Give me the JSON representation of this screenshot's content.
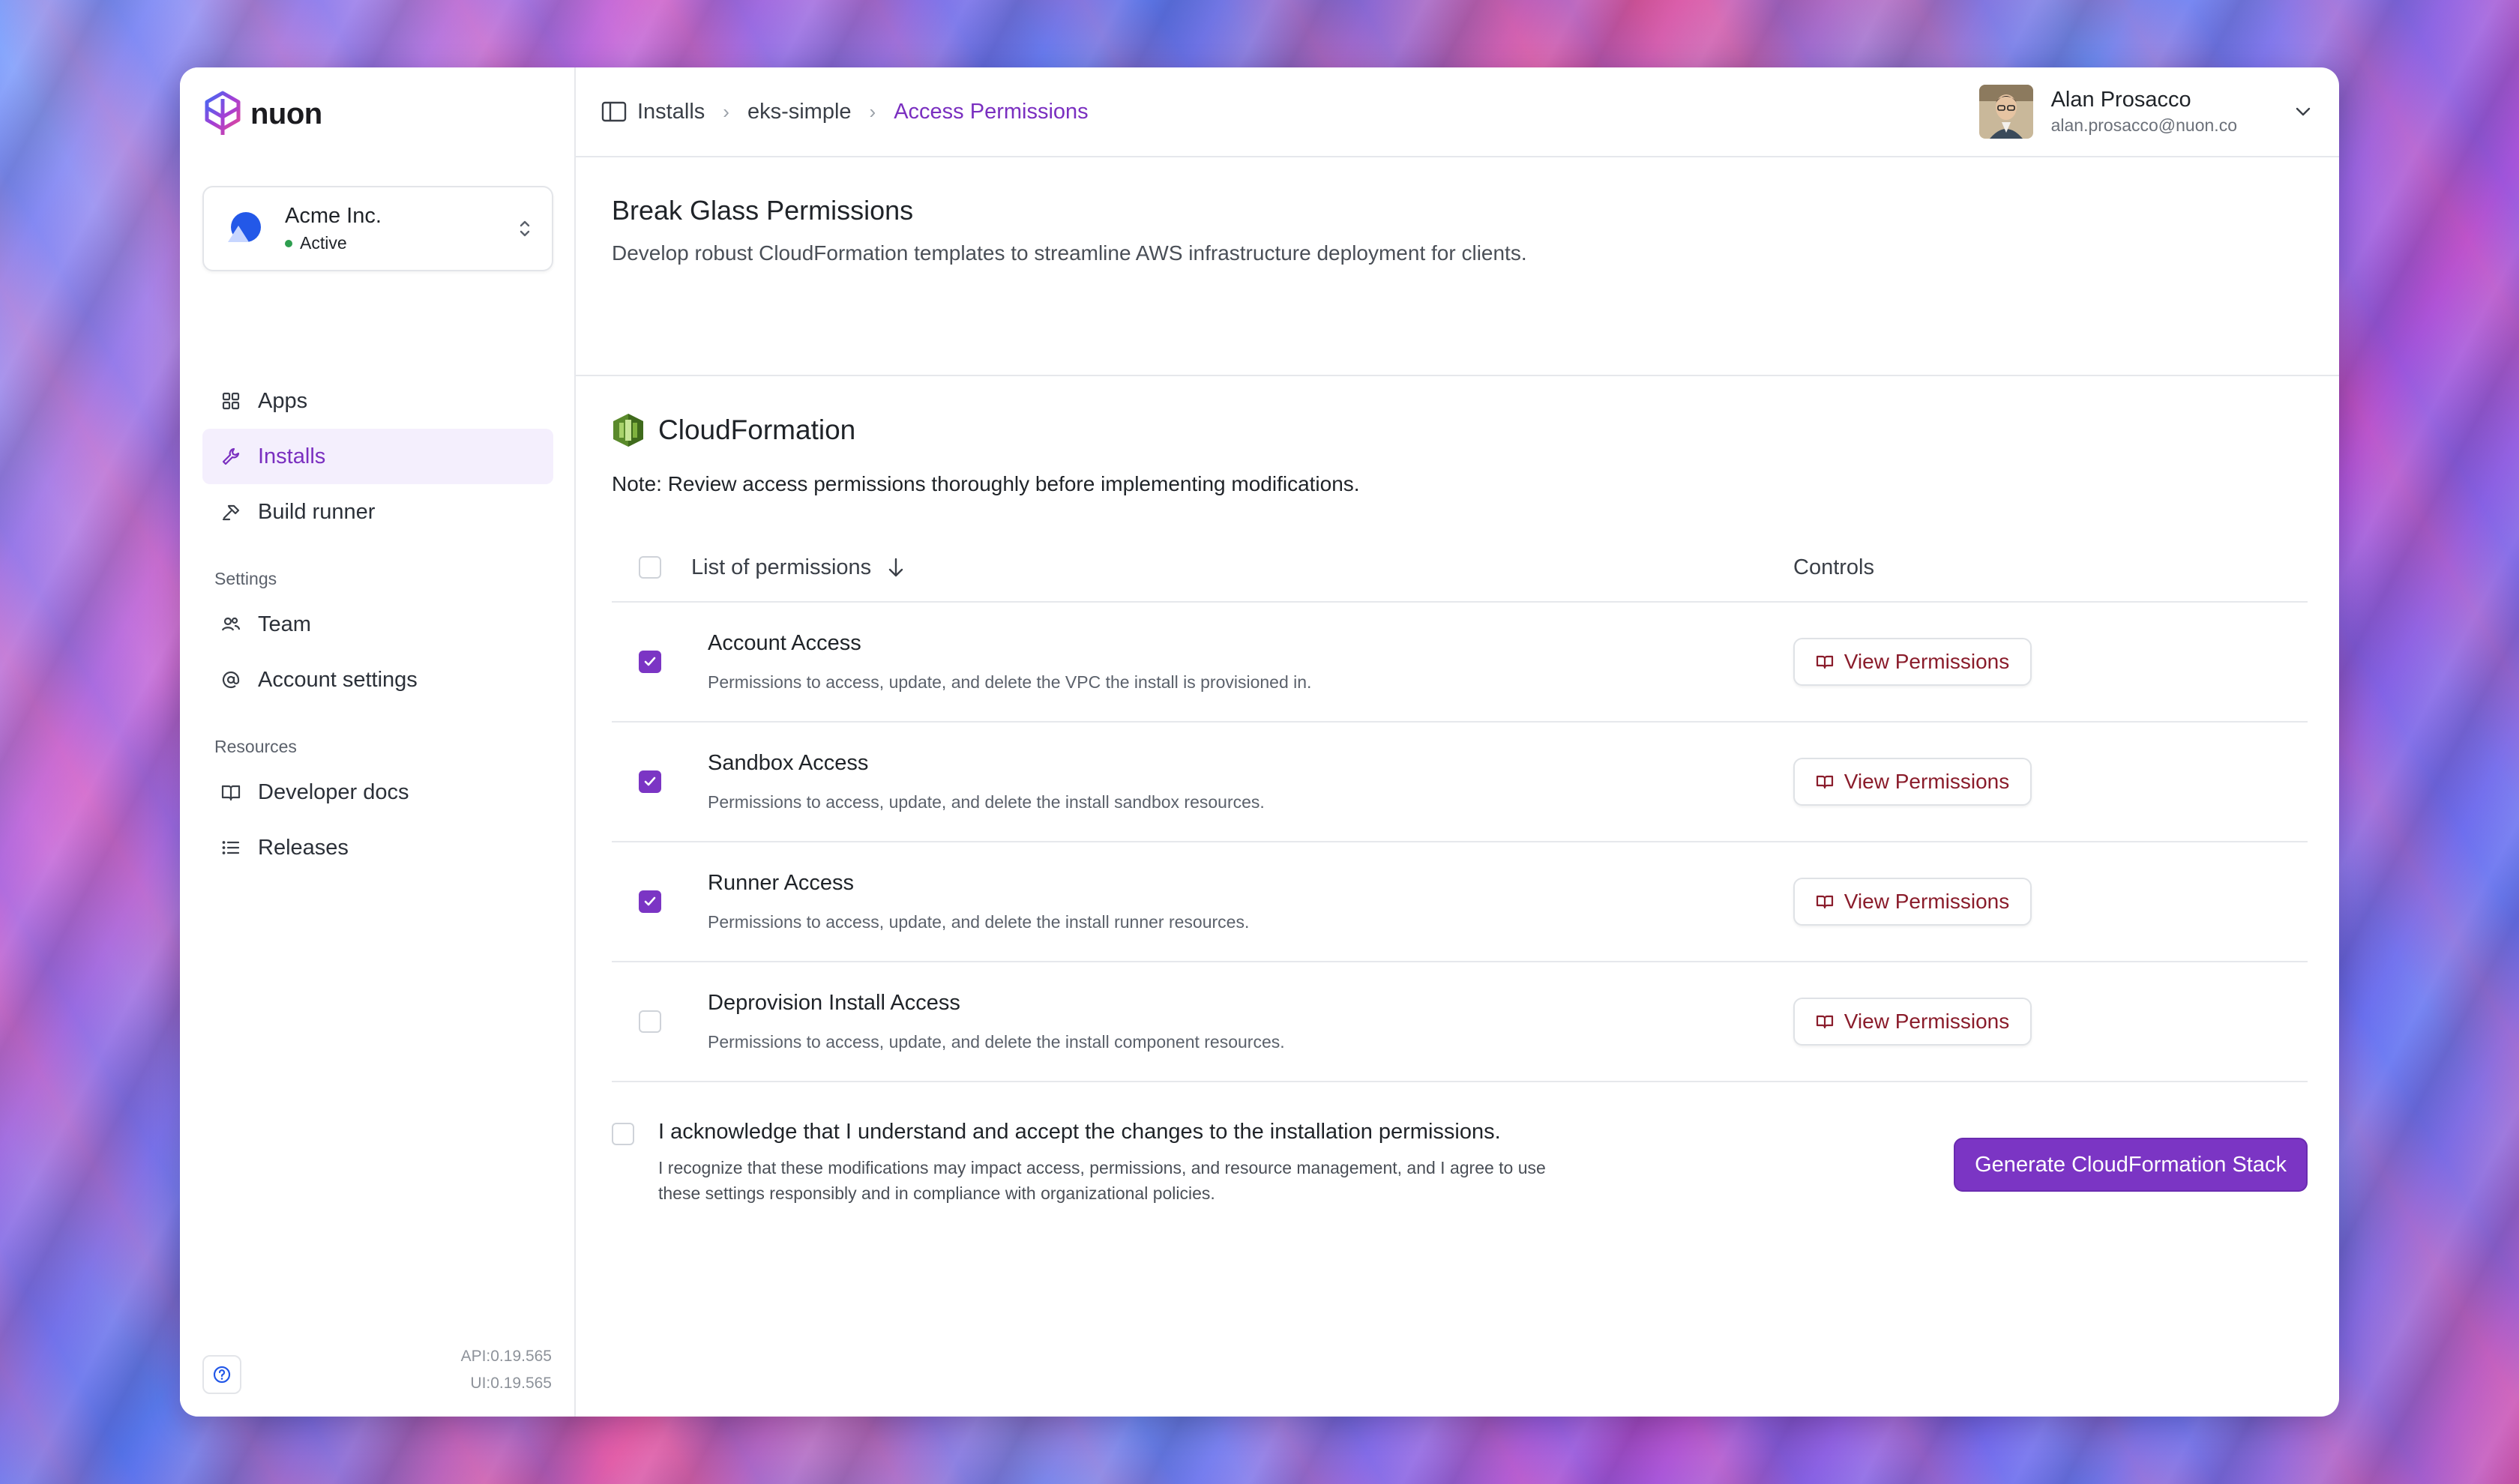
{
  "app": {
    "brand": "nuon"
  },
  "org": {
    "name": "Acme Inc.",
    "status": "Active"
  },
  "sidebar": {
    "items": [
      {
        "label": "Apps"
      },
      {
        "label": "Installs"
      },
      {
        "label": "Build runner"
      }
    ],
    "settings_heading": "Settings",
    "settings_items": [
      {
        "label": "Team"
      },
      {
        "label": "Account settings"
      }
    ],
    "resources_heading": "Resources",
    "resources_items": [
      {
        "label": "Developer docs"
      },
      {
        "label": "Releases"
      }
    ],
    "api_version": "API:0.19.565",
    "ui_version": "UI:0.19.565"
  },
  "breadcrumb": [
    "Installs",
    "eks-simple",
    "Access Permissions"
  ],
  "user": {
    "name": "Alan Prosacco",
    "email": "alan.prosacco@nuon.co"
  },
  "page": {
    "title": "Break Glass Permissions",
    "description": "Develop robust CloudFormation templates to streamline AWS infrastructure deployment for clients."
  },
  "cloudformation": {
    "title": "CloudFormation",
    "note": "Note: Review access permissions thoroughly before implementing modifications."
  },
  "table": {
    "col_list": "List of permissions",
    "col_controls": "Controls",
    "view_label": "View Permissions",
    "rows": [
      {
        "title": "Account Access",
        "desc": "Permissions to access, update, and delete the VPC the install is provisioned in.",
        "checked": true
      },
      {
        "title": "Sandbox Access",
        "desc": "Permissions to access, update, and delete the install sandbox resources.",
        "checked": true
      },
      {
        "title": "Runner Access",
        "desc": "Permissions to access, update, and delete the install runner resources.",
        "checked": true
      },
      {
        "title": "Deprovision Install Access",
        "desc": "Permissions to access, update, and delete the install component resources.",
        "checked": false
      }
    ]
  },
  "acknowledge": {
    "title": "I acknowledge that I understand and accept the changes to the installation permissions.",
    "desc": "I recognize that these modifications may impact access, permissions, and resource management, and I agree to use these settings responsibly and in compliance with organizational policies.",
    "checked": false
  },
  "actions": {
    "generate_label": "Generate CloudFormation Stack"
  },
  "colors": {
    "accent": "#7b35c4",
    "link_red": "#8a1c2b",
    "status_green": "#2e9e4f"
  }
}
